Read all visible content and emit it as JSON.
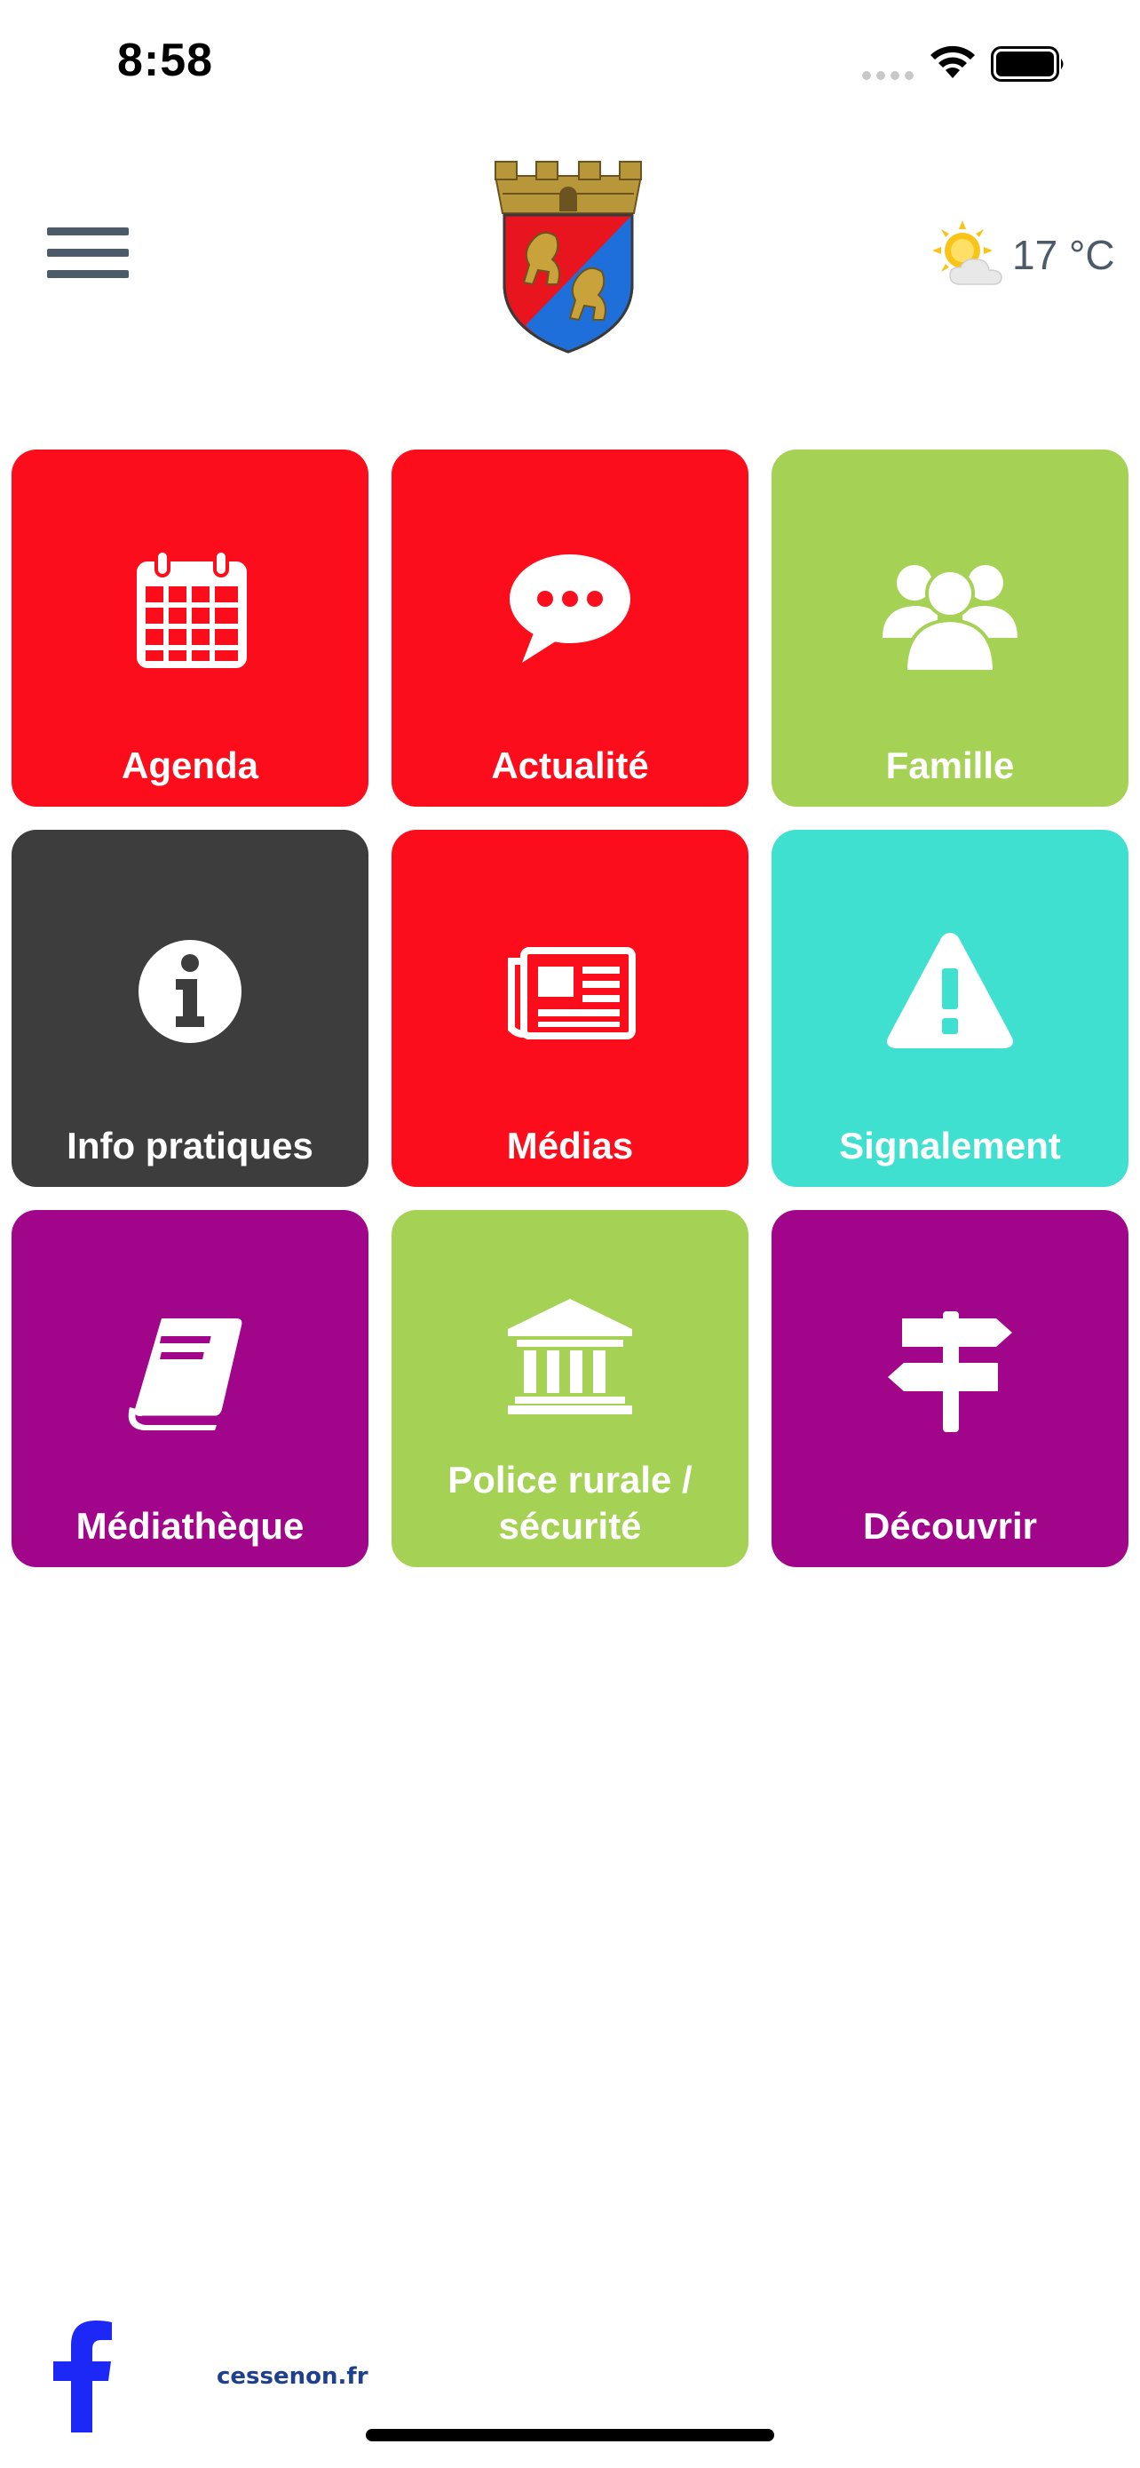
{
  "status_bar": {
    "time": "8:58"
  },
  "header": {
    "weather": {
      "temperature": "17 °C",
      "icon": "sun-cloud-icon"
    }
  },
  "tiles": [
    {
      "label": "Agenda",
      "icon": "calendar-icon",
      "color": "#fc0d1b"
    },
    {
      "label": "Actualité",
      "icon": "speech-bubble-icon",
      "color": "#fc0d1b"
    },
    {
      "label": "Famille",
      "icon": "group-icon",
      "color": "#a5d155"
    },
    {
      "label": "Info pratiques",
      "icon": "info-icon",
      "color": "#3d3d3d"
    },
    {
      "label": "Médias",
      "icon": "newspaper-icon",
      "color": "#fc0d1b"
    },
    {
      "label": "Signalement",
      "icon": "warning-icon",
      "color": "#40e0d0"
    },
    {
      "label": "Médiathèque",
      "icon": "book-icon",
      "color": "#a1058a"
    },
    {
      "label": "Police rurale / sécurité",
      "icon": "bank-icon",
      "color": "#a5d155"
    },
    {
      "label": "Découvrir",
      "icon": "signpost-icon",
      "color": "#a1058a"
    }
  ],
  "footer": {
    "link": "cessenon.fr",
    "facebook_color": "#1c28f5"
  }
}
